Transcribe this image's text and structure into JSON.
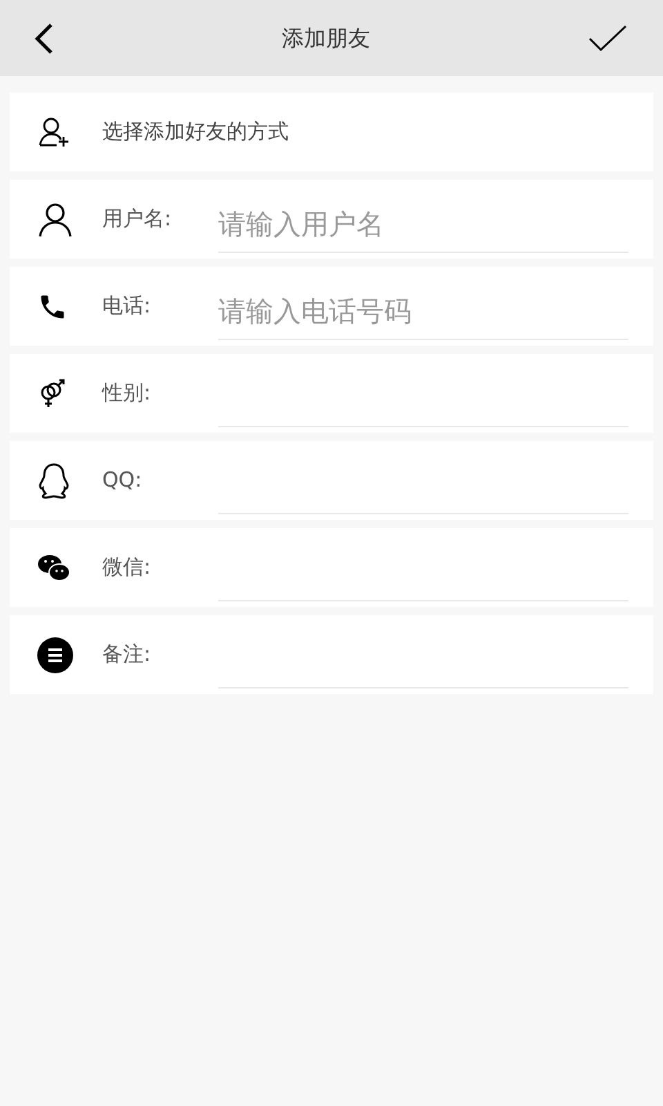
{
  "header": {
    "title": "添加朋友"
  },
  "method_row": {
    "kind": "person-add",
    "label": "选择添加好友的方式"
  },
  "fields": [
    {
      "kind": "person",
      "label": "用户名:",
      "placeholder": "请输入用户名"
    },
    {
      "kind": "phone",
      "label": "电话:",
      "placeholder": "请输入电话号码"
    },
    {
      "kind": "gender",
      "label": "性别:"
    },
    {
      "kind": "penguin",
      "label": "QQ:"
    },
    {
      "kind": "chat",
      "label": "微信:"
    },
    {
      "kind": "note",
      "label": "备注:"
    }
  ]
}
